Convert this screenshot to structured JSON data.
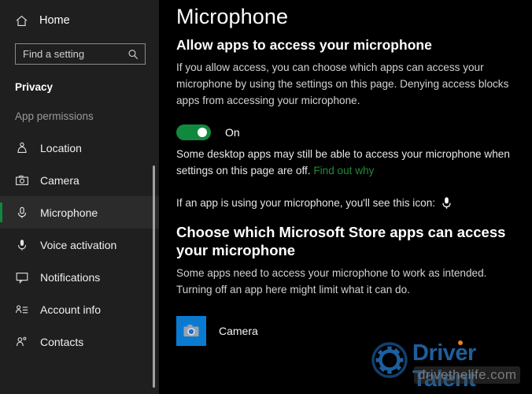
{
  "sidebar": {
    "home": {
      "label": "Home",
      "icon": "home-icon"
    },
    "search": {
      "placeholder": "Find a setting",
      "value": "",
      "icon": "search-icon"
    },
    "section_title": "Privacy",
    "group_header": "App permissions",
    "items": [
      {
        "label": "Location",
        "icon": "location-pin-icon",
        "selected": false
      },
      {
        "label": "Camera",
        "icon": "camera-icon",
        "selected": false
      },
      {
        "label": "Microphone",
        "icon": "microphone-icon",
        "selected": true
      },
      {
        "label": "Voice activation",
        "icon": "voice-activation-icon",
        "selected": false
      },
      {
        "label": "Notifications",
        "icon": "notification-balloon-icon",
        "selected": false
      },
      {
        "label": "Account info",
        "icon": "account-info-icon",
        "selected": false
      },
      {
        "label": "Contacts",
        "icon": "contacts-icon",
        "selected": false
      }
    ]
  },
  "main": {
    "page_title": "Microphone",
    "allow_section": {
      "heading": "Allow apps to access your microphone",
      "description": "If you allow access, you can choose which apps can access your microphone by using the settings on this page. Denying access blocks apps from accessing your microphone.",
      "toggle_state": "On",
      "toggle_on": true,
      "desktop_note_part1": "Some desktop apps may still be able to access your microphone when settings on this page are off. ",
      "desktop_note_link": "Find out why",
      "icon_note": "If an app is using your microphone, you'll see this icon:",
      "icon_note_glyph": "microphone-icon"
    },
    "apps_section": {
      "heading": "Choose which Microsoft Store apps can access your microphone",
      "description": "Some apps need to access your microphone to work as intended. Turning off an app here might limit what it can do.",
      "apps": [
        {
          "name": "Camera",
          "icon": "camera-app-icon",
          "toggle_state": "On",
          "toggle_on": true
        }
      ]
    }
  },
  "watermark": {
    "brand": "Driver Talent",
    "url": "drivethelife.com",
    "icon": "gear-icon"
  },
  "colors": {
    "accent_green": "#10893e",
    "link_green": "#1f8a3b",
    "sidebar_bg": "#1f1f1f",
    "content_bg": "#000000",
    "app_tile_blue": "#0a7ad1",
    "watermark_blue": "#1d5f9e",
    "watermark_orange": "#e8821a"
  }
}
